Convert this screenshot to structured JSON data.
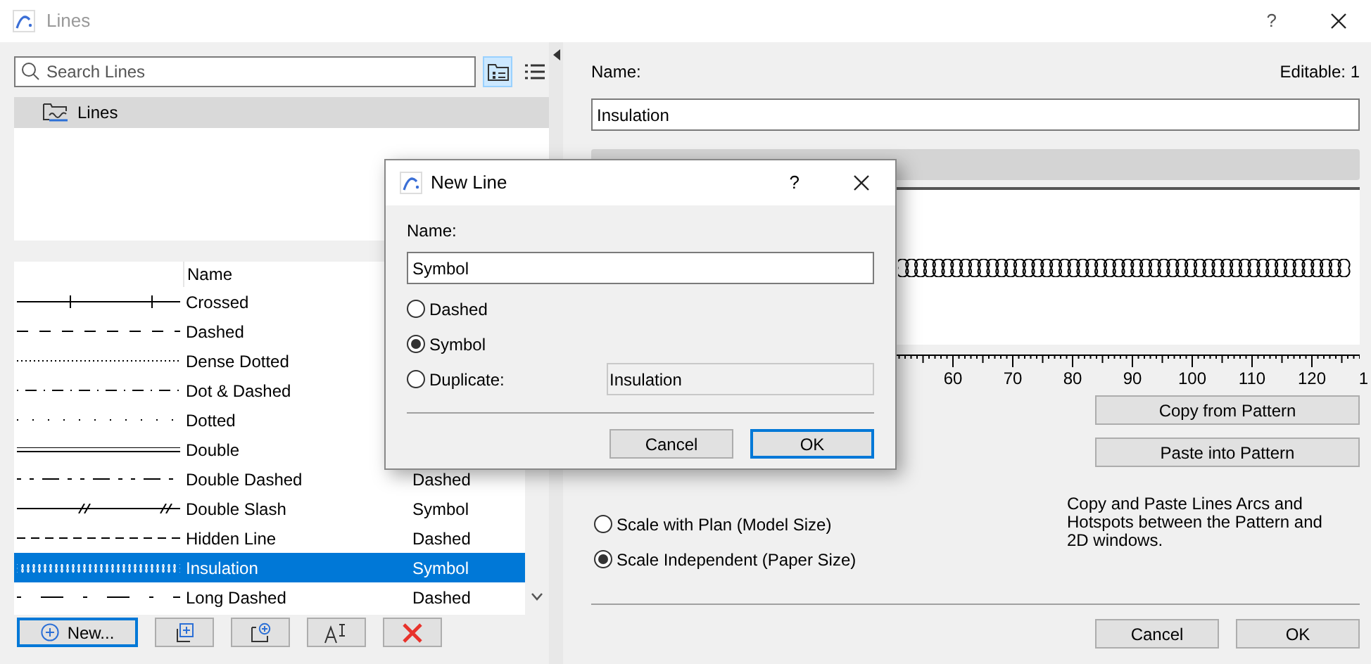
{
  "window": {
    "title": "Lines",
    "help": "?"
  },
  "search": {
    "placeholder": "Search Lines"
  },
  "view_toggles": [
    {
      "kind": "folder",
      "selected": true
    },
    {
      "kind": "list",
      "selected": false
    }
  ],
  "tree": [
    {
      "label": "Lines",
      "selected": true
    }
  ],
  "list": {
    "columns": [
      "Name"
    ],
    "rows": [
      {
        "kind": "crossed",
        "name": "Crossed",
        "selected": false
      },
      {
        "kind": "dashed",
        "name": "Dashed",
        "selected": false
      },
      {
        "kind": "dense-dotted",
        "name": "Dense Dotted",
        "selected": false
      },
      {
        "kind": "dot-dash",
        "name": "Dot & Dashed",
        "selected": false
      },
      {
        "kind": "dotted",
        "name": "Dotted",
        "selected": false
      },
      {
        "kind": "double",
        "name": "Double",
        "selected": false
      },
      {
        "kind": "double-dashed",
        "name": "Double Dashed",
        "type": "Dashed",
        "selected": false
      },
      {
        "kind": "double-slash",
        "name": "Double Slash",
        "type": "Symbol",
        "selected": false
      },
      {
        "kind": "hidden",
        "name": "Hidden Line",
        "type": "Dashed",
        "selected": false
      },
      {
        "kind": "insulation",
        "name": "Insulation",
        "type": "Symbol",
        "selected": true
      },
      {
        "kind": "long-dashed",
        "name": "Long Dashed",
        "type": "Dashed",
        "selected": false
      }
    ]
  },
  "list_buttons": [
    {
      "kind": "new",
      "label": "New...",
      "default": true
    },
    {
      "kind": "duplicate",
      "default": false
    },
    {
      "kind": "new-folder",
      "default": false
    },
    {
      "kind": "rename",
      "default": false
    },
    {
      "kind": "delete",
      "default": false
    }
  ],
  "editor": {
    "name_label": "Name:",
    "editable": "Editable: 1",
    "name_value": "Insulation",
    "ruler_labels": [
      "60",
      "70",
      "80",
      "90",
      "100",
      "110",
      "120",
      "1"
    ],
    "pattern_buttons": [
      "Copy from Pattern",
      "Paste into Pattern"
    ],
    "description": "Copy and Paste Lines Arcs and Hotspots between the Pattern and 2D windows.",
    "scale_options": [
      {
        "label": "Scale with Plan (Model Size)",
        "selected": false
      },
      {
        "label": "Scale Independent (Paper Size)",
        "selected": true
      }
    ],
    "buttons": [
      {
        "label": "Cancel",
        "default": false
      },
      {
        "label": "OK",
        "default": false
      }
    ]
  },
  "dialog": {
    "title": "New Line",
    "help": "?",
    "name_label": "Name:",
    "name_value": "Symbol",
    "options": [
      {
        "label": "Dashed",
        "selected": false
      },
      {
        "label": "Symbol",
        "selected": true
      },
      {
        "label": "Duplicate:",
        "selected": false
      }
    ],
    "duplicate_value": "Insulation",
    "buttons": [
      {
        "label": "Cancel",
        "default": false
      },
      {
        "label": "OK",
        "default": true
      }
    ]
  }
}
